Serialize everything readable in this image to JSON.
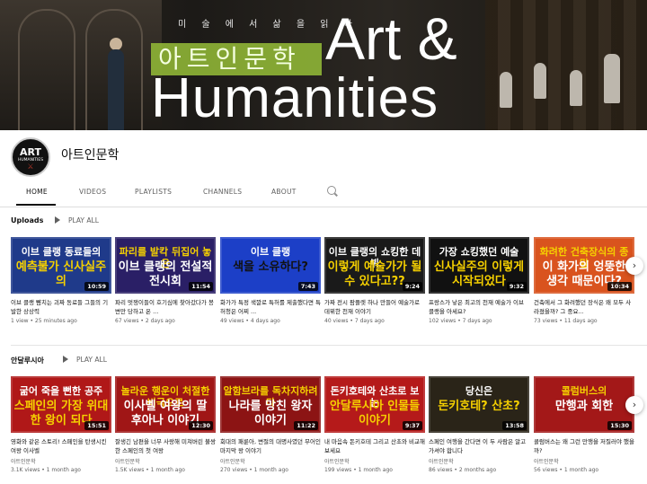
{
  "banner": {
    "subtitle": "미 술 에 서 삶 을 읽 다",
    "title_ko": "아트인문학",
    "title_en_1": "Art &",
    "title_en_2": "Humanities"
  },
  "channel": {
    "name": "아트인문학",
    "avatar_line1": "ART",
    "avatar_line2": "HUMANITIES",
    "avatar_line3": "⚔"
  },
  "tabs": [
    "HOME",
    "VIDEOS",
    "PLAYLISTS",
    "CHANNELS",
    "ABOUT"
  ],
  "uploads": {
    "title": "Uploads",
    "play_all": "PLAY ALL",
    "videos": [
      {
        "t1": "이브 클랭 동료들의",
        "t2": "예측불가 신사실주의",
        "duration": "10:59",
        "title": "이브 클랭 뺨치는 괴짜 동료들 그들의 기발한 상상력",
        "channel": "",
        "meta": "1 view • 25 minutes ago",
        "bg": "#1f3a8a",
        "c1": "#ffffff",
        "c2": "#f5d000"
      },
      {
        "t1": "파리를 발칵 뒤집어 놓은",
        "t2": "이브 클랭의 전설적 전시회",
        "duration": "11:54",
        "title": "파리 멋쟁이들이 호기심에 찾아갔다가 봉변만 당하고 온 ...",
        "channel": "",
        "meta": "67 views • 2 days ago",
        "bg": "#2a1f66",
        "c1": "#f5d000",
        "c2": "#ffffff"
      },
      {
        "t1": "이브 클랭",
        "t2": "색을 소유하다?",
        "duration": "7:43",
        "title": "화가가 특정 색깔로 특허를 제출했다면 특허청은 어찌 ...",
        "channel": "",
        "meta": "49 views • 4 days ago",
        "bg": "#1c3fc7",
        "c1": "#ffffff",
        "c2": "#111111"
      },
      {
        "t1": "이브 클랭의 쇼킹한 데뷔",
        "t2": "이렇게 예술가가 될 수 있다고??",
        "duration": "9:24",
        "title": "가짜 전시 팜플렛 하나 만들어 예술가로 데뷔한 천재 이야기",
        "channel": "",
        "meta": "40 views • 7 days ago",
        "bg": "#1a1a1a",
        "c1": "#ffffff",
        "c2": "#f5d000"
      },
      {
        "t1": "가장 쇼킹했던 예술",
        "t2": "신사실주의 이렇게 시작되었다",
        "duration": "9:32",
        "title": "프랑스가 낳은 최고의 천재 예술가 이브 클랭을 아세요?",
        "channel": "",
        "meta": "102 views • 7 days ago",
        "bg": "#111111",
        "c1": "#ffffff",
        "c2": "#f5d000"
      },
      {
        "t1": "화려한 건축장식의 종말",
        "t2": "이 화가의 엉뚱한 생각 때문이다?",
        "duration": "10:34",
        "title": "건축에서 그 화려했던 장식은 왜 모두 사라졌을까? 그 중요...",
        "channel": "",
        "meta": "73 views • 11 days ago",
        "bg": "#d9531e",
        "c1": "#f5d000",
        "c2": "#ffffff"
      }
    ]
  },
  "andalusia": {
    "title": "안달루시아",
    "play_all": "PLAY ALL",
    "videos": [
      {
        "t1": "굶어 죽을 뻔한 공주",
        "t2": "스페인의 가장 위대한 왕이 되다",
        "duration": "15:51",
        "title": "영화와 같은 스토리! 스페인을 탄생시킨 여왕 이사벨",
        "channel": "아트인문학",
        "meta": "3.1K views • 1 month ago",
        "bg": "#b01818",
        "c1": "#ffffff",
        "c2": "#f5d000"
      },
      {
        "t1": "놀라운 행운이 처절한 비극으로",
        "t2": "이사벨 여왕의 딸 후아나 이야기",
        "duration": "12:30",
        "title": "잘생긴 남편을 너무 사랑해 미쳐버린 불쌍한 스페인의 첫 여왕",
        "channel": "아트인문학",
        "meta": "1.5K views • 1 month ago",
        "bg": "#a01616",
        "c1": "#f5d000",
        "c2": "#ffffff"
      },
      {
        "t1": "알함브라를 독차지하려다",
        "t2": "나라를 망친 왕자 이야기",
        "duration": "11:22",
        "title": "회대의 패륜아, 변절의 대명사였던 무어인 마지막 왕 이야기",
        "channel": "아트인문학",
        "meta": "270 views • 1 month ago",
        "bg": "#8c1414",
        "c1": "#f5d000",
        "c2": "#ffffff"
      },
      {
        "t1": "돈키호테와 산초로 보는",
        "t2": "안달루시아 인물들 이야기",
        "duration": "9:37",
        "title": "내 마음속 돈키호테 그리고 산초와 비교해 보세요",
        "channel": "아트인문학",
        "meta": "199 views • 1 month ago",
        "bg": "#b51a1a",
        "c1": "#ffffff",
        "c2": "#f5d000"
      },
      {
        "t1": "당신은",
        "t2": "돈키호테? 산초?",
        "duration": "13:58",
        "title": "스페인 여행을 간다면 이 두 사람은 알고 가셔야 합니다",
        "channel": "아트인문학",
        "meta": "86 views • 2 months ago",
        "bg": "#2a2418",
        "c1": "#ffffff",
        "c2": "#f5d000"
      },
      {
        "t1": "콜럼버스의",
        "t2": "만행과 회한",
        "duration": "15:30",
        "title": "콜럼버스는 왜 그런 만행을 저질러야 했을까?",
        "channel": "아트인문학",
        "meta": "56 views • 1 month ago",
        "bg": "#a31818",
        "c1": "#f5d000",
        "c2": "#ffffff"
      }
    ]
  }
}
